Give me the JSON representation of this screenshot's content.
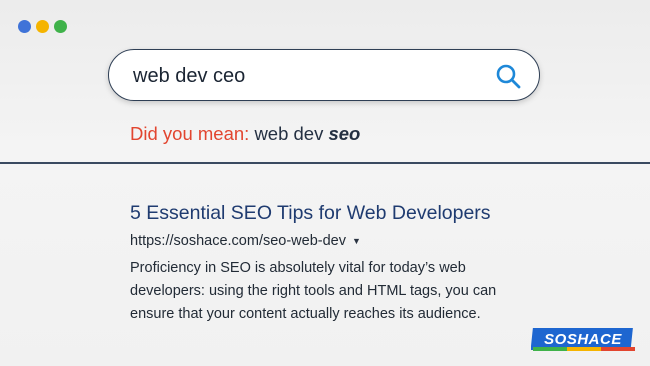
{
  "window": {
    "dot_colors": [
      "#3f73d8",
      "#f5b400",
      "#3fb24a"
    ]
  },
  "search": {
    "query": "web dev ceo",
    "icon": "search-icon",
    "accent_color": "#1e88d8"
  },
  "suggestion": {
    "prefix": "Did you mean:",
    "plain": "web dev",
    "emphasis": "seo",
    "prefix_color": "#e2452f"
  },
  "result": {
    "title": "5 Essential SEO Tips for Web Developers",
    "url": "https://soshace.com/seo-web-dev",
    "caret_icon": "caret-down-icon",
    "snippet": "Proficiency in SEO is absolutely vital for today’s web developers: using the right tools and HTML tags, you can ensure that your content actually reaches its audience."
  },
  "brand": {
    "logo_text": "SOSHACE",
    "colors": [
      "#1e66d0",
      "#f5b400",
      "#3fb24a"
    ]
  }
}
